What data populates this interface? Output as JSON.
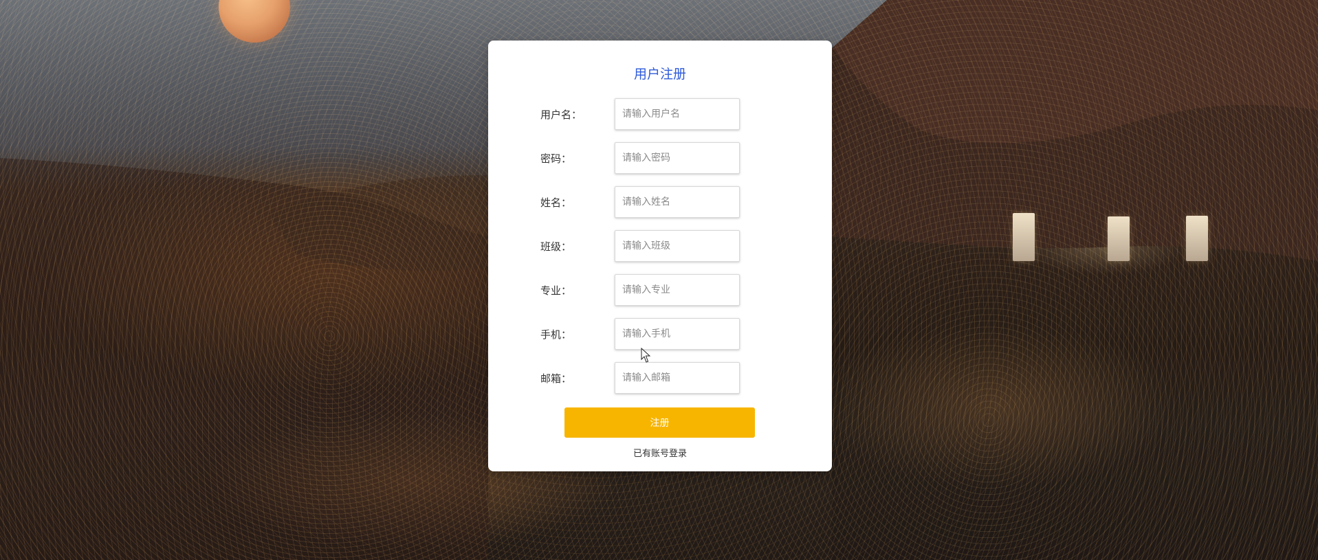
{
  "form": {
    "title": "用户注册",
    "fields": [
      {
        "label": "用户名：",
        "placeholder": "请输入用户名",
        "value": ""
      },
      {
        "label": "密码：",
        "placeholder": "请输入密码",
        "value": ""
      },
      {
        "label": "姓名：",
        "placeholder": "请输入姓名",
        "value": ""
      },
      {
        "label": "班级：",
        "placeholder": "请输入班级",
        "value": ""
      },
      {
        "label": "专业：",
        "placeholder": "请输入专业",
        "value": ""
      },
      {
        "label": "手机：",
        "placeholder": "请输入手机",
        "value": ""
      },
      {
        "label": "邮箱：",
        "placeholder": "请输入邮箱",
        "value": ""
      }
    ],
    "submit_label": "注册",
    "login_link": "已有账号登录"
  },
  "colors": {
    "title": "#2f5bd8",
    "submit_bg": "#f7b500",
    "submit_text": "#ffffff",
    "card_bg": "#ffffff"
  },
  "icons": {
    "cursor": "mouse-pointer-icon"
  }
}
